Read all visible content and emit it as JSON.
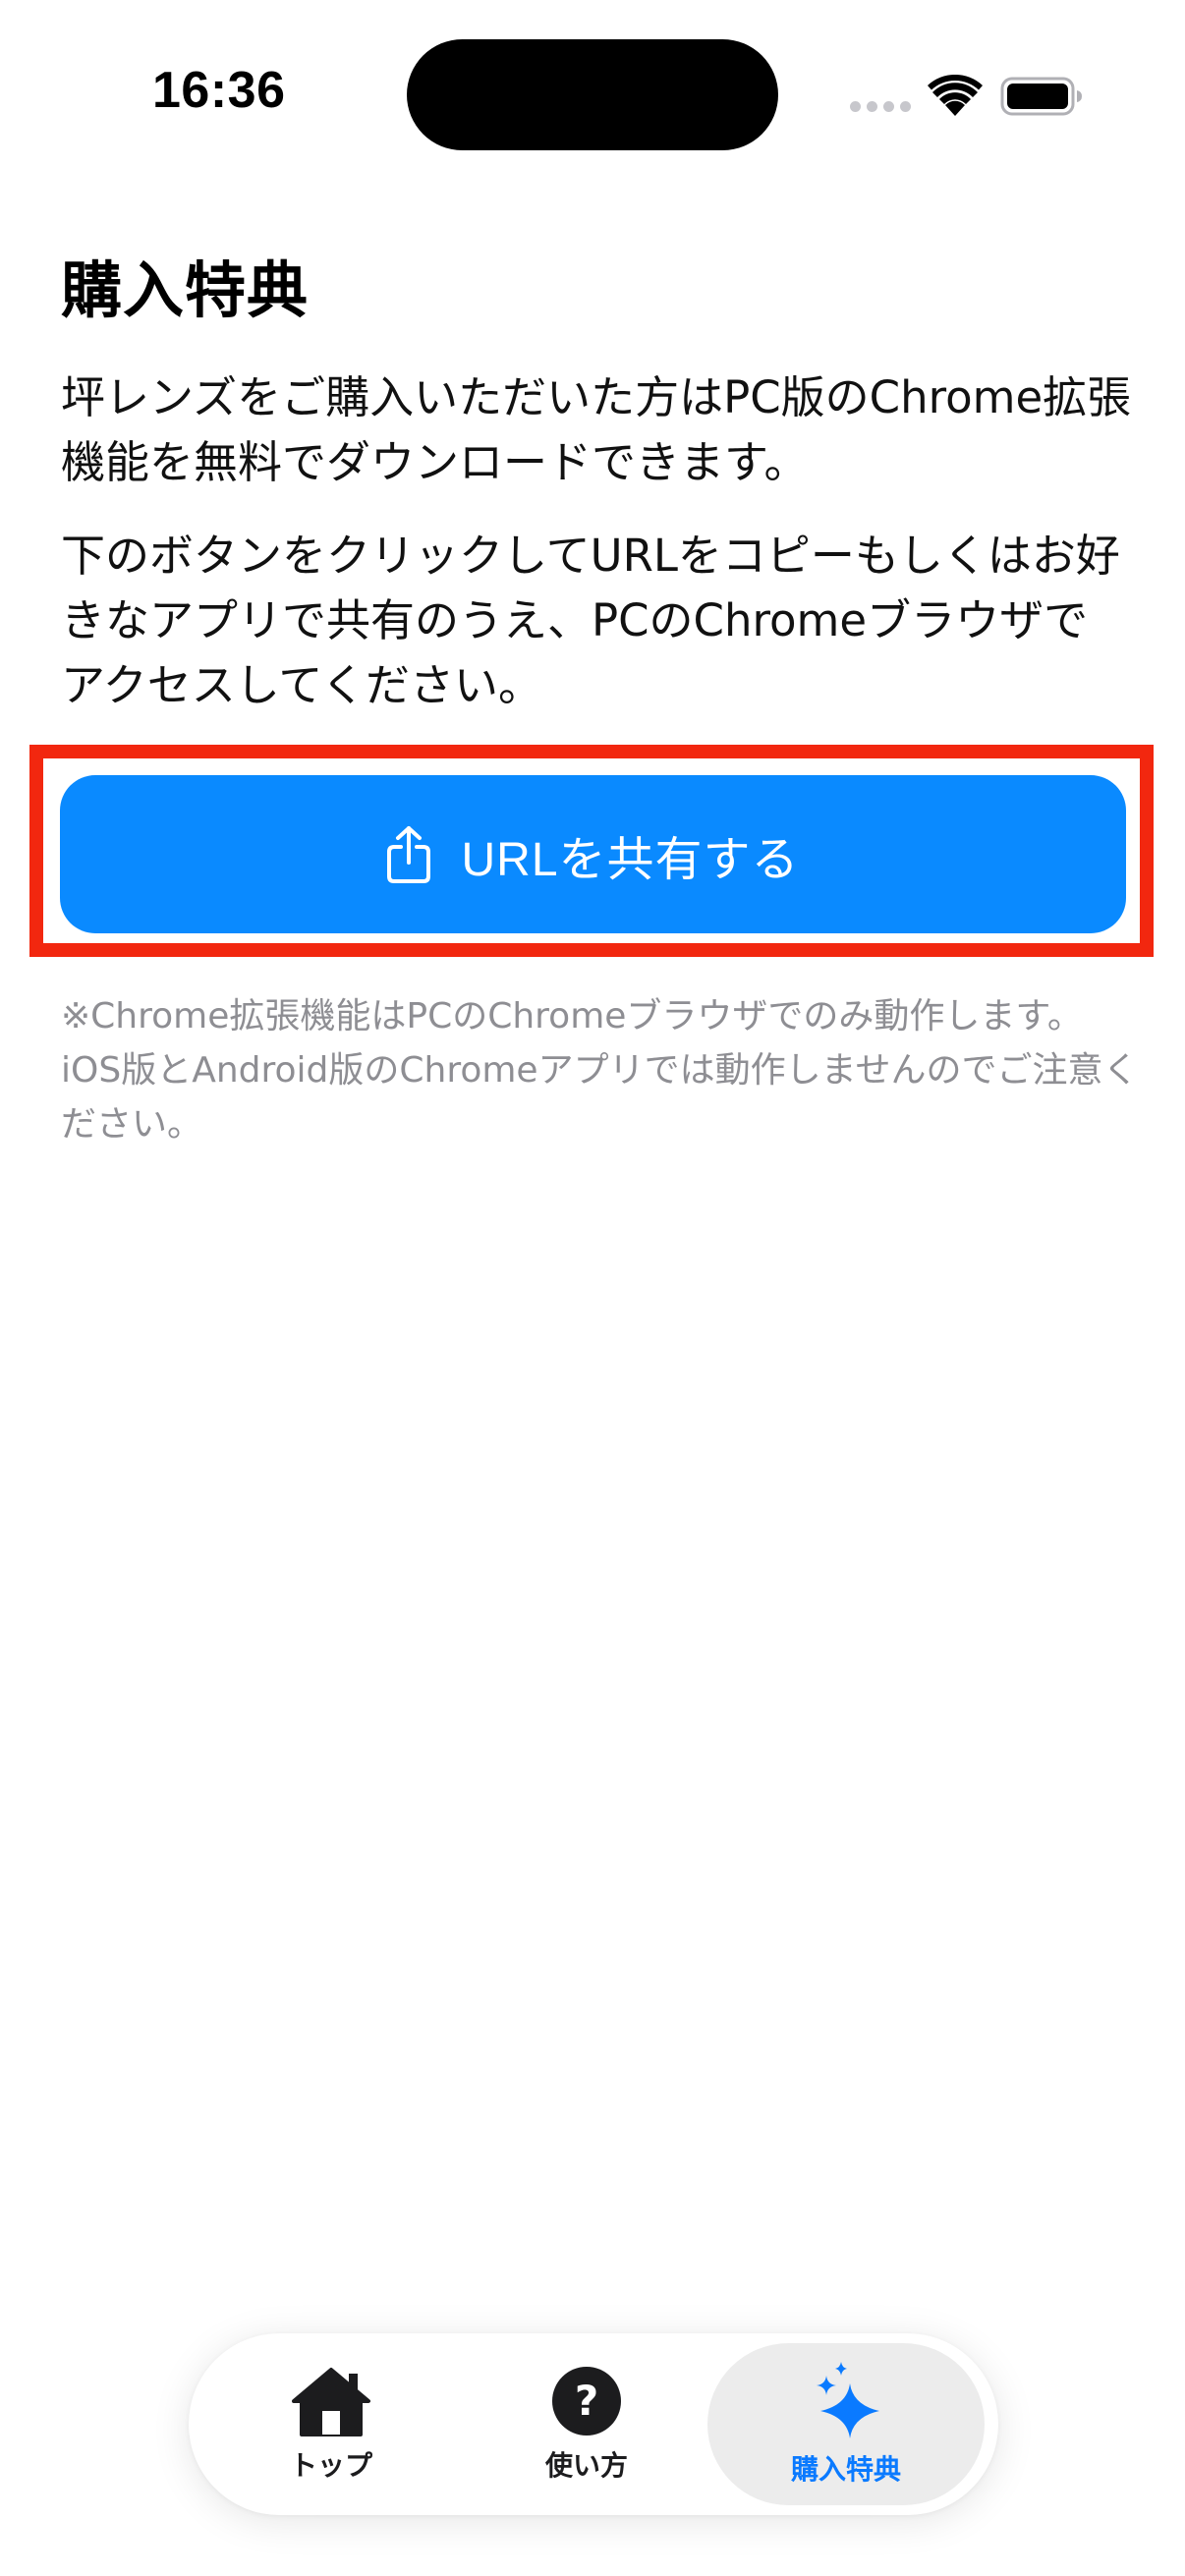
{
  "status_bar": {
    "time": "16:36"
  },
  "page": {
    "title": "購入特典",
    "paragraph_1": "坪レンズをご購入いただいた方はPC版のChrome拡張機能を無料でダウンロードできます。",
    "paragraph_2": "下のボタンをクリックしてURLをコピーもしくはお好きなアプリで共有のうえ、PCのChromeブラウザでアクセスしてください。",
    "share_button_label": "URLを共有する",
    "note": "※Chrome拡張機能はPCのChromeブラウザでのみ動作します。iOS版とAndroid版のChromeアプリでは動作しませんのでご注意ください。"
  },
  "tab_bar": {
    "tabs": [
      {
        "label": "トップ",
        "icon": "house-icon"
      },
      {
        "label": "使い方",
        "icon": "question-circle-icon"
      },
      {
        "label": "購入特典",
        "icon": "sparkles-icon",
        "selected": true
      }
    ]
  },
  "colors": {
    "accent": "#0a8aff",
    "highlight_border": "#f2270f",
    "tab_selected": "#0a7aff",
    "note_text": "#8e8e93"
  }
}
